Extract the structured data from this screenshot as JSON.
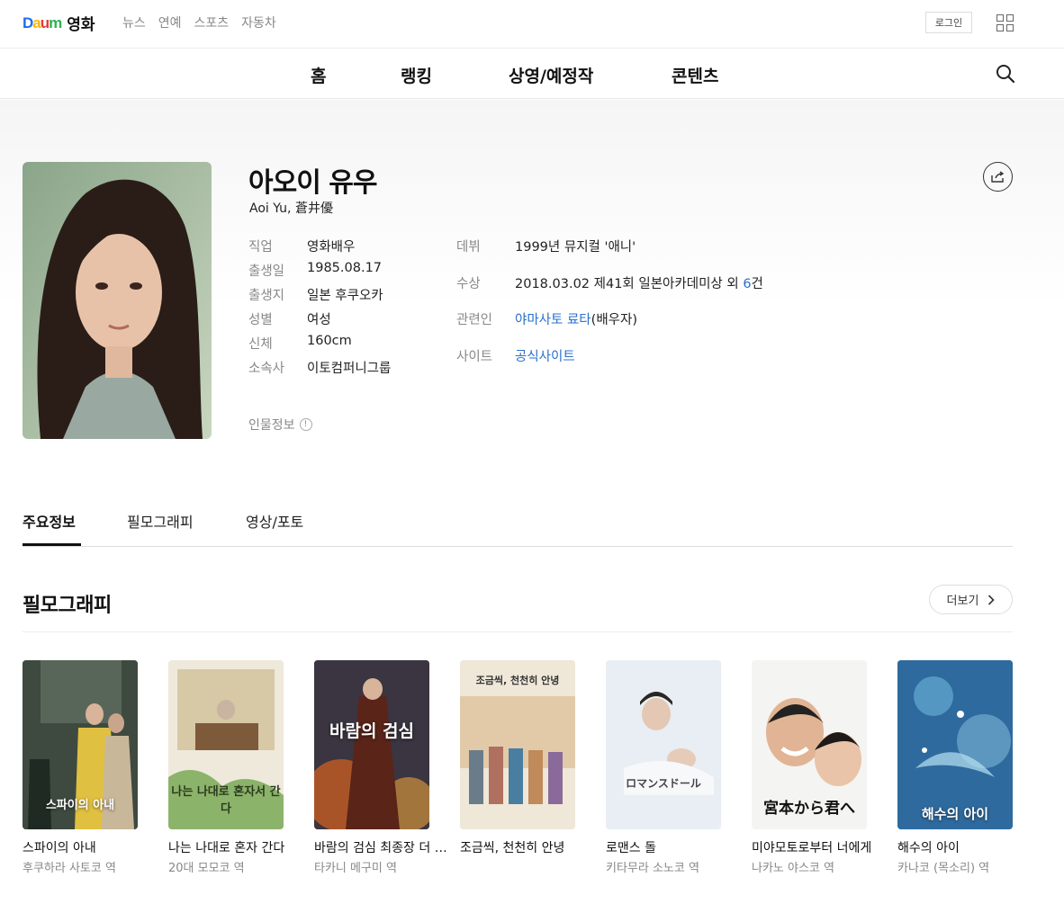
{
  "header": {
    "logo_text": "영화",
    "gnb": [
      "뉴스",
      "연예",
      "스포츠",
      "자동차"
    ],
    "login_label": "로그인"
  },
  "nav": {
    "tabs": [
      "홈",
      "랭킹",
      "상영/예정작",
      "콘텐츠"
    ]
  },
  "person": {
    "name": "아오이 유우",
    "name_sub": "Aoi Yu, 蒼井優",
    "left_info": [
      {
        "label": "직업",
        "value": "영화배우"
      },
      {
        "label": "출생일",
        "value": "1985.08.17"
      },
      {
        "label": "출생지",
        "value": "일본 후쿠오카"
      },
      {
        "label": "성별",
        "value": "여성"
      },
      {
        "label": "신체",
        "value": "160cm"
      },
      {
        "label": "소속사",
        "value": "이토컴퍼니그룹"
      }
    ],
    "debut_label": "데뷔",
    "debut_value": "1999년 뮤지컬 '애니'",
    "award_label": "수상",
    "award_value": "2018.03.02 제41회 일본아카데미상 외 ",
    "award_count": "6",
    "award_suffix": "건",
    "related_label": "관련인",
    "related_link": "야마사토 료타",
    "related_suffix": "(배우자)",
    "site_label": "사이트",
    "site_link": "공식사이트",
    "note": "인물정보",
    "note_icon": "!"
  },
  "subtabs": [
    "주요정보",
    "필모그래피",
    "영상/포토"
  ],
  "filmography": {
    "title": "필모그래피",
    "more_label": "더보기",
    "movies": [
      {
        "title": "스파이의 아내",
        "role": "후쿠하라 사토코 역",
        "poster_text": "스파이의 아내"
      },
      {
        "title": "나는 나대로 혼자 간다",
        "role": "20대 모모코 역",
        "poster_text": "나는 나대로 혼자서 간다"
      },
      {
        "title": "바람의 검심 최종장 더 비기닝",
        "role": "타카니 메구미 역",
        "poster_text": "바람의 검심"
      },
      {
        "title": "조금씩, 천천히 안녕",
        "role": "",
        "poster_text": "조금씩, 천천히 안녕"
      },
      {
        "title": "로맨스 돌",
        "role": "키타무라 소노코 역",
        "poster_text": "ロマンスドール"
      },
      {
        "title": "미야모토로부터 너에게",
        "role": "나카노 야스코 역",
        "poster_text": "宮本から君へ"
      },
      {
        "title": "해수의 아이",
        "role": "카나코 (목소리) 역",
        "poster_text": "해수의 아이"
      }
    ]
  },
  "colors": {
    "link": "#2a6fce",
    "accent": "#111111"
  }
}
